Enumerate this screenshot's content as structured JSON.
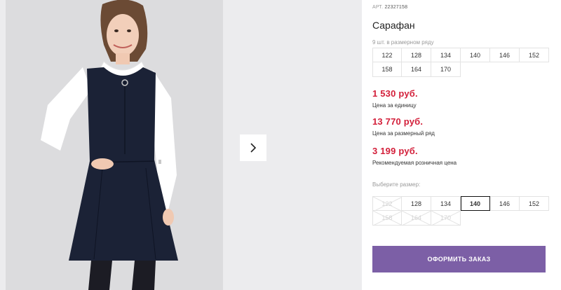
{
  "product": {
    "art_label": "АРТ.",
    "art_number": "22327158",
    "title": "Сарафан"
  },
  "size_row": {
    "caption": "9 шт. в размерном ряду",
    "sizes": [
      "122",
      "128",
      "134",
      "140",
      "146",
      "152",
      "158",
      "164",
      "170"
    ]
  },
  "prices": {
    "unit_price": "1 530 руб.",
    "unit_label": "Цена за единицу",
    "row_price": "13 770 руб.",
    "row_label": "Цена за размерный ряд",
    "retail_price": "3 199 руб.",
    "retail_label": "Рекомендуемая розничная цена"
  },
  "size_picker": {
    "caption": "Выберите размер:",
    "sizes": [
      {
        "label": "122",
        "available": false
      },
      {
        "label": "128",
        "available": true
      },
      {
        "label": "134",
        "available": true
      },
      {
        "label": "140",
        "available": true,
        "selected": true
      },
      {
        "label": "146",
        "available": true
      },
      {
        "label": "152",
        "available": true
      },
      {
        "label": "158",
        "available": false
      },
      {
        "label": "164",
        "available": false
      },
      {
        "label": "170",
        "available": false
      }
    ]
  },
  "actions": {
    "order_label": "ОФОРМИТЬ ЗАКАЗ"
  },
  "gallery": {
    "next_icon": "chevron-right-icon"
  },
  "colors": {
    "price": "#d31f3a",
    "order_button": "#7c5fa6",
    "dress": "#1b2236"
  }
}
